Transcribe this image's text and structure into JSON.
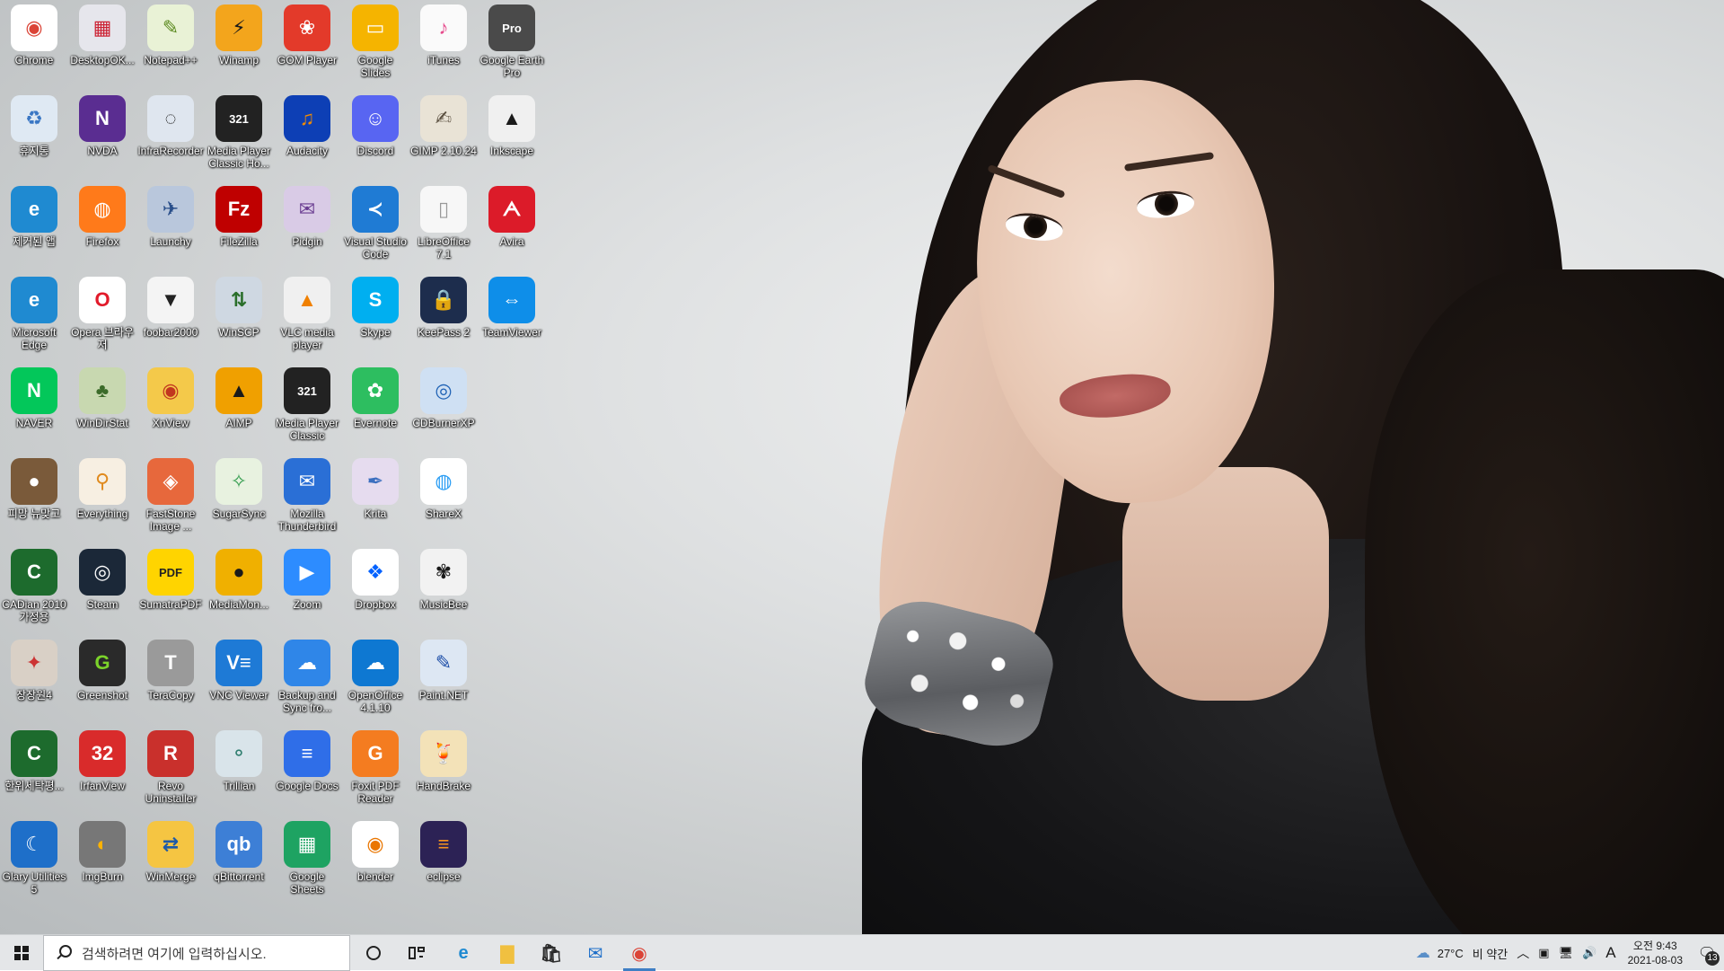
{
  "desktop": {
    "columns": [
      [
        {
          "label": "Chrome",
          "icon": "chrome-icon",
          "bg": "#ffffff",
          "fg": "#db4437",
          "glyph": "◉"
        },
        {
          "label": "휴지통",
          "icon": "recycle-bin-icon",
          "bg": "#dfe9f3",
          "fg": "#3a77c4",
          "glyph": "♻"
        },
        {
          "label": "제거된 앱",
          "icon": "edge-icon",
          "bg": "#1f8ad1",
          "fg": "#ffffff",
          "glyph": "e"
        },
        {
          "label": "Microsoft Edge",
          "icon": "edge-icon",
          "bg": "#1f8ad1",
          "fg": "#ffffff",
          "glyph": "e"
        },
        {
          "label": "NAVER",
          "icon": "naver-icon",
          "bg": "#03c75a",
          "fg": "#ffffff",
          "glyph": "N"
        },
        {
          "label": "피망 뉴맞고",
          "icon": "pmang-icon",
          "bg": "#7a5a3a",
          "fg": "#ffffff",
          "glyph": "●"
        },
        {
          "label": "CADian 2010 가정용",
          "icon": "cadian-icon",
          "bg": "#1d6b2d",
          "fg": "#ffffff",
          "glyph": "C"
        },
        {
          "label": "장장원4",
          "icon": "game-icon",
          "bg": "#d9d0c6",
          "fg": "#c33",
          "glyph": "✦"
        },
        {
          "label": "한위세탁평...",
          "icon": "cadian-icon",
          "bg": "#1d6b2d",
          "fg": "#ffffff",
          "glyph": "C"
        },
        {
          "label": "Glary Utilities 5",
          "icon": "glary-icon",
          "bg": "#1e6fc9",
          "fg": "#ffffff",
          "glyph": "☾"
        }
      ],
      [
        {
          "label": "DesktopOK...",
          "icon": "desktopok-icon",
          "bg": "#e6e6ec",
          "fg": "#c23",
          "glyph": "▦"
        },
        {
          "label": "NVDA",
          "icon": "nvda-icon",
          "bg": "#5a2d91",
          "fg": "#ffffff",
          "glyph": "N"
        },
        {
          "label": "Firefox",
          "icon": "firefox-icon",
          "bg": "#ff7a1a",
          "fg": "#ffffff",
          "glyph": "◍"
        },
        {
          "label": "Opera 브라우저",
          "icon": "opera-icon",
          "bg": "#ffffff",
          "fg": "#e21a2a",
          "glyph": "O"
        },
        {
          "label": "WinDirStat",
          "icon": "windirstat-icon",
          "bg": "#c8d8b0",
          "fg": "#3c6b2a",
          "glyph": "♣"
        },
        {
          "label": "Everything",
          "icon": "everything-icon",
          "bg": "#f7efe2",
          "fg": "#e08a1e",
          "glyph": "⚲"
        },
        {
          "label": "Steam",
          "icon": "steam-icon",
          "bg": "#1b2838",
          "fg": "#ffffff",
          "glyph": "◎"
        },
        {
          "label": "Greenshot",
          "icon": "greenshot-icon",
          "bg": "#2a2a2a",
          "fg": "#7bd32a",
          "glyph": "G"
        },
        {
          "label": "IrfanView",
          "icon": "irfanview-icon",
          "bg": "#d92b2b",
          "fg": "#ffffff",
          "glyph": "32"
        },
        {
          "label": "ImgBurn",
          "icon": "imgburn-icon",
          "bg": "#777777",
          "fg": "#ffb300",
          "glyph": "◐"
        }
      ],
      [
        {
          "label": "Notepad++",
          "icon": "notepadpp-icon",
          "bg": "#e9f2d6",
          "fg": "#5b8a1f",
          "glyph": "✎"
        },
        {
          "label": "InfraRecorder",
          "icon": "infrarecorder-icon",
          "bg": "#dfe6ef",
          "fg": "#1a1a1a",
          "glyph": "◌"
        },
        {
          "label": "Launchy",
          "icon": "launchy-icon",
          "bg": "#b9c7dc",
          "fg": "#2a4f8a",
          "glyph": "✈"
        },
        {
          "label": "foobar2000",
          "icon": "foobar-icon",
          "bg": "#f4f4f4",
          "fg": "#222222",
          "glyph": "▼"
        },
        {
          "label": "XnView",
          "icon": "xnview-icon",
          "bg": "#f4c94a",
          "fg": "#c2361f",
          "glyph": "◉"
        },
        {
          "label": "FastStone Image ...",
          "icon": "faststone-icon",
          "bg": "#e7683c",
          "fg": "#ffffff",
          "glyph": "◈"
        },
        {
          "label": "SumatraPDF",
          "icon": "sumatrapdf-icon",
          "bg": "#ffd400",
          "fg": "#222222",
          "glyph": "PDF"
        },
        {
          "label": "TeraCopy",
          "icon": "teracopy-icon",
          "bg": "#9a9a9a",
          "fg": "#ffffff",
          "glyph": "T"
        },
        {
          "label": "Revo Uninstaller",
          "icon": "revo-icon",
          "bg": "#c9302c",
          "fg": "#ffffff",
          "glyph": "R"
        },
        {
          "label": "WinMerge",
          "icon": "winmerge-icon",
          "bg": "#f5c542",
          "fg": "#1e5aa8",
          "glyph": "⇄"
        }
      ],
      [
        {
          "label": "Winamp",
          "icon": "winamp-icon",
          "bg": "#f3a51c",
          "fg": "#1a1a1a",
          "glyph": "⚡"
        },
        {
          "label": "Media Player Classic Ho...",
          "icon": "mpc-icon",
          "bg": "#222222",
          "fg": "#ffffff",
          "glyph": "321"
        },
        {
          "label": "FileZilla",
          "icon": "filezilla-icon",
          "bg": "#bf0000",
          "fg": "#ffffff",
          "glyph": "Fz"
        },
        {
          "label": "WinSCP",
          "icon": "winscp-icon",
          "bg": "#cfd8e2",
          "fg": "#2a6e2a",
          "glyph": "⇅"
        },
        {
          "label": "AIMP",
          "icon": "aimp-icon",
          "bg": "#f0a000",
          "fg": "#1a1a1a",
          "glyph": "▲"
        },
        {
          "label": "SugarSync",
          "icon": "sugarsync-icon",
          "bg": "#e8f2e0",
          "fg": "#2e9a4a",
          "glyph": "✧"
        },
        {
          "label": "MediaMon...",
          "icon": "mediamonkey-icon",
          "bg": "#f0b000",
          "fg": "#1a1a1a",
          "glyph": "●"
        },
        {
          "label": "VNC Viewer",
          "icon": "vnc-icon",
          "bg": "#1e7ad6",
          "fg": "#ffffff",
          "glyph": "V≡"
        },
        {
          "label": "Trillian",
          "icon": "trillian-icon",
          "bg": "#d9e4ea",
          "fg": "#2e7d6e",
          "glyph": "⚬"
        },
        {
          "label": "qBittorrent",
          "icon": "qbittorrent-icon",
          "bg": "#3d7fd6",
          "fg": "#ffffff",
          "glyph": "qb"
        }
      ],
      [
        {
          "label": "GOM Player",
          "icon": "gomplayer-icon",
          "bg": "#e33a2a",
          "fg": "#ffffff",
          "glyph": "❀"
        },
        {
          "label": "Audacity",
          "icon": "audacity-icon",
          "bg": "#0d3fb5",
          "fg": "#f28c00",
          "glyph": "♫"
        },
        {
          "label": "Pidgin",
          "icon": "pidgin-icon",
          "bg": "#d9cbe6",
          "fg": "#6a3d91",
          "glyph": "✉"
        },
        {
          "label": "VLC media player",
          "icon": "vlc-icon",
          "bg": "#f0f0f0",
          "fg": "#f08000",
          "glyph": "▲"
        },
        {
          "label": "Media Player Classic",
          "icon": "mpc-icon",
          "bg": "#222222",
          "fg": "#ffffff",
          "glyph": "321"
        },
        {
          "label": "Mozilla Thunderbird",
          "icon": "thunderbird-icon",
          "bg": "#2a6fd6",
          "fg": "#ffffff",
          "glyph": "✉"
        },
        {
          "label": "Zoom",
          "icon": "zoom-icon",
          "bg": "#2d8cff",
          "fg": "#ffffff",
          "glyph": "▶"
        },
        {
          "label": "Backup and Sync fro...",
          "icon": "backup-sync-icon",
          "bg": "#2f86e8",
          "fg": "#ffffff",
          "glyph": "☁"
        },
        {
          "label": "Google Docs",
          "icon": "google-docs-icon",
          "bg": "#2f6ee8",
          "fg": "#ffffff",
          "glyph": "≡"
        },
        {
          "label": "Google Sheets",
          "icon": "google-sheets-icon",
          "bg": "#1ea362",
          "fg": "#ffffff",
          "glyph": "▦"
        }
      ],
      [
        {
          "label": "Google Slides",
          "icon": "google-slides-icon",
          "bg": "#f5b400",
          "fg": "#ffffff",
          "glyph": "▭"
        },
        {
          "label": "Discord",
          "icon": "discord-icon",
          "bg": "#5865f2",
          "fg": "#ffffff",
          "glyph": "☺"
        },
        {
          "label": "Visual Studio Code",
          "icon": "vscode-icon",
          "bg": "#1f7bd4",
          "fg": "#ffffff",
          "glyph": "≺"
        },
        {
          "label": "Skype",
          "icon": "skype-icon",
          "bg": "#00aff0",
          "fg": "#ffffff",
          "glyph": "S"
        },
        {
          "label": "Evernote",
          "icon": "evernote-icon",
          "bg": "#2dbe60",
          "fg": "#ffffff",
          "glyph": "✿"
        },
        {
          "label": "Krita",
          "icon": "krita-icon",
          "bg": "#e6dcef",
          "fg": "#3b6fbf",
          "glyph": "✒"
        },
        {
          "label": "Dropbox",
          "icon": "dropbox-icon",
          "bg": "#ffffff",
          "fg": "#0061ff",
          "glyph": "❖"
        },
        {
          "label": "OpenOffice 4.1.10",
          "icon": "openoffice-icon",
          "bg": "#0e78d2",
          "fg": "#ffffff",
          "glyph": "☁"
        },
        {
          "label": "Foxit PDF Reader",
          "icon": "foxit-icon",
          "bg": "#f47c20",
          "fg": "#ffffff",
          "glyph": "G"
        },
        {
          "label": "blender",
          "icon": "blender-icon",
          "bg": "#ffffff",
          "fg": "#ea7600",
          "glyph": "◉"
        }
      ],
      [
        {
          "label": "iTunes",
          "icon": "itunes-icon",
          "bg": "#fafafa",
          "fg": "#e64a8c",
          "glyph": "♪"
        },
        {
          "label": "GIMP 2.10.24",
          "icon": "gimp-icon",
          "bg": "#e9e3d6",
          "fg": "#5a4f3f",
          "glyph": "✍"
        },
        {
          "label": "LibreOffice 7.1",
          "icon": "libreoffice-icon",
          "bg": "#f7f7f7",
          "fg": "#999999",
          "glyph": "▯"
        },
        {
          "label": "KeePass 2",
          "icon": "keepass-icon",
          "bg": "#1d2d4d",
          "fg": "#ffffff",
          "glyph": "🔒"
        },
        {
          "label": "CDBurnerXP",
          "icon": "cdburnerxp-icon",
          "bg": "#cfe0f3",
          "fg": "#1f62b5",
          "glyph": "◎"
        },
        {
          "label": "ShareX",
          "icon": "sharex-icon",
          "bg": "#ffffff",
          "fg": "#2a9df4",
          "glyph": "◍"
        },
        {
          "label": "MusicBee",
          "icon": "musicbee-icon",
          "bg": "#f2f2f2",
          "fg": "#1a1a1a",
          "glyph": "✾"
        },
        {
          "label": "Paint.NET",
          "icon": "paintnet-icon",
          "bg": "#dde7f3",
          "fg": "#1e4fa8",
          "glyph": "✎"
        },
        {
          "label": "HandBrake",
          "icon": "handbrake-icon",
          "bg": "#f3e2b8",
          "fg": "#c0392b",
          "glyph": "🍹"
        },
        {
          "label": "eclipse",
          "icon": "eclipse-icon",
          "bg": "#2c2255",
          "fg": "#f7941e",
          "glyph": "≡"
        }
      ],
      [
        {
          "label": "Google Earth Pro",
          "icon": "google-earth-icon",
          "bg": "#4a4a4a",
          "fg": "#ffffff",
          "glyph": "Pro"
        },
        {
          "label": "Inkscape",
          "icon": "inkscape-icon",
          "bg": "#f0f0f0",
          "fg": "#1a1a1a",
          "glyph": "▲"
        },
        {
          "label": "Avira",
          "icon": "avira-icon",
          "bg": "#dc1b29",
          "fg": "#ffffff",
          "glyph": "ᗅ"
        },
        {
          "label": "TeamViewer",
          "icon": "teamviewer-icon",
          "bg": "#0e8ee9",
          "fg": "#ffffff",
          "glyph": "⇔"
        }
      ]
    ]
  },
  "taskbar": {
    "search_placeholder": "검색하려면 여기에 입력하십시오.",
    "pinned": [
      {
        "name": "edge-taskbar-icon",
        "glyph": "e",
        "color": "#1f8ad1"
      },
      {
        "name": "file-explorer-taskbar-icon",
        "glyph": "▇",
        "color": "#f0c040"
      },
      {
        "name": "store-taskbar-icon",
        "glyph": "🛍",
        "color": "#2a2a2a"
      },
      {
        "name": "mail-taskbar-icon",
        "glyph": "✉",
        "color": "#1e6fc9"
      },
      {
        "name": "chrome-taskbar-icon",
        "glyph": "◉",
        "color": "#db4437"
      }
    ],
    "weather_temp": "27°C",
    "weather_desc": "비 약간",
    "ime_label": "A",
    "clock_time": "오전 9:43",
    "clock_date": "2021-08-03",
    "notification_count": "13"
  },
  "colors": {
    "taskbar_bg": "#e4e6e8",
    "active_indicator": "#3f7fc4"
  }
}
